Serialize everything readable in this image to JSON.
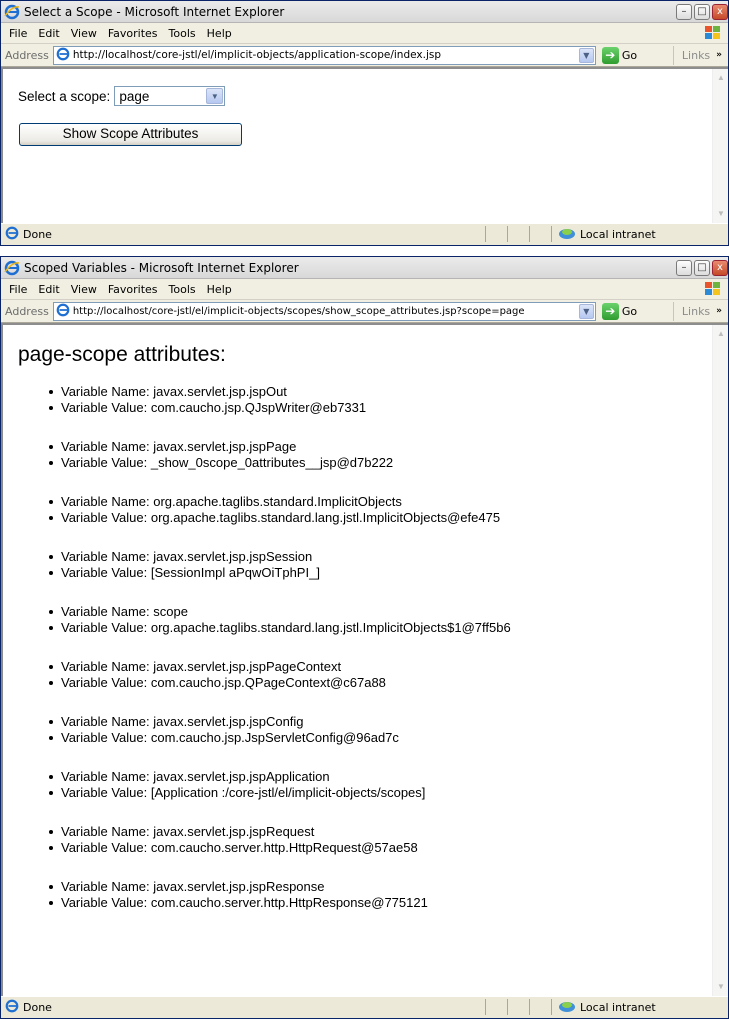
{
  "window1": {
    "title": "Select a Scope - Microsoft Internet Explorer",
    "menu": [
      "File",
      "Edit",
      "View",
      "Favorites",
      "Tools",
      "Help"
    ],
    "address_label": "Address",
    "url": "http://localhost/core-jstl/el/implicit-objects/application-scope/index.jsp",
    "go_label": "Go",
    "links_label": "Links",
    "select_label": "Select a scope:",
    "select_value": "page",
    "button_label": "Show Scope Attributes",
    "status": "Done",
    "zone": "Local intranet"
  },
  "window2": {
    "title": "Scoped Variables - Microsoft Internet Explorer",
    "menu": [
      "File",
      "Edit",
      "View",
      "Favorites",
      "Tools",
      "Help"
    ],
    "address_label": "Address",
    "url": "http://localhost/core-jstl/el/implicit-objects/scopes/show_scope_attributes.jsp?scope=page",
    "go_label": "Go",
    "links_label": "Links",
    "heading": "page-scope attributes:",
    "attributes": [
      {
        "name": "Variable Name: javax.servlet.jsp.jspOut",
        "value": "Variable Value: com.caucho.jsp.QJspWriter@eb7331"
      },
      {
        "name": "Variable Name: javax.servlet.jsp.jspPage",
        "value": "Variable Value: _show_0scope_0attributes__jsp@d7b222"
      },
      {
        "name": "Variable Name: org.apache.taglibs.standard.ImplicitObjects",
        "value": "Variable Value: org.apache.taglibs.standard.lang.jstl.ImplicitObjects@efe475"
      },
      {
        "name": "Variable Name: javax.servlet.jsp.jspSession",
        "value": "Variable Value: [SessionImpl aPqwOiTphPI_]"
      },
      {
        "name": "Variable Name: scope",
        "value": "Variable Value: org.apache.taglibs.standard.lang.jstl.ImplicitObjects$1@7ff5b6"
      },
      {
        "name": "Variable Name: javax.servlet.jsp.jspPageContext",
        "value": "Variable Value: com.caucho.jsp.QPageContext@c67a88"
      },
      {
        "name": "Variable Name: javax.servlet.jsp.jspConfig",
        "value": "Variable Value: com.caucho.jsp.JspServletConfig@96ad7c"
      },
      {
        "name": "Variable Name: javax.servlet.jsp.jspApplication",
        "value": "Variable Value: [Application :/core-jstl/el/implicit-objects/scopes]"
      },
      {
        "name": "Variable Name: javax.servlet.jsp.jspRequest",
        "value": "Variable Value: com.caucho.server.http.HttpRequest@57ae58"
      },
      {
        "name": "Variable Name: javax.servlet.jsp.jspResponse",
        "value": "Variable Value: com.caucho.server.http.HttpResponse@775121"
      }
    ],
    "status": "Done",
    "zone": "Local intranet"
  }
}
